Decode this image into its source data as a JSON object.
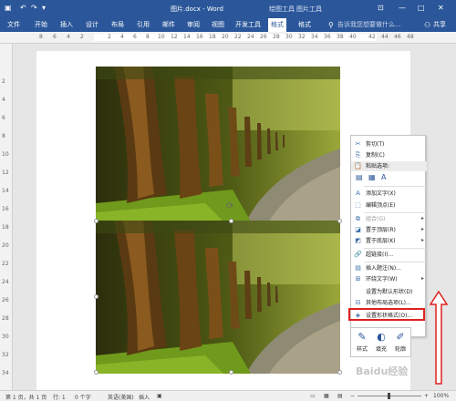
{
  "titlebar": {
    "doc_title": "图片.docx - Word",
    "context_tab_drawing": "绘图工具",
    "context_tab_picture": "图片工具",
    "colors": {
      "bar": "#2b579a"
    }
  },
  "tabs": [
    "文件",
    "开始",
    "插入",
    "设计",
    "布局",
    "引用",
    "邮件",
    "审阅",
    "视图",
    "开发工具",
    "格式",
    "格式"
  ],
  "tell_me": {
    "placeholder": "告诉我您想要做什么..."
  },
  "share": {
    "label": "共享"
  },
  "ruler": {
    "h_numbers": [
      "8",
      "6",
      "4",
      "2",
      "2",
      "4",
      "6",
      "8",
      "10",
      "12",
      "14",
      "16",
      "18",
      "20",
      "22",
      "24",
      "26",
      "28",
      "30",
      "32",
      "34",
      "36",
      "38",
      "40",
      "42",
      "44",
      "46",
      "48"
    ],
    "v_numbers": [
      "2",
      "4",
      "6",
      "8",
      "10",
      "12",
      "14",
      "16",
      "18",
      "20",
      "22",
      "24",
      "26",
      "28",
      "30",
      "32",
      "34"
    ]
  },
  "context_menu": {
    "items": [
      {
        "label": "剪切(T)",
        "icon": "cut-icon",
        "disabled": false,
        "submenu": false
      },
      {
        "label": "复制(C)",
        "icon": "copy-icon",
        "disabled": false,
        "submenu": false
      },
      {
        "label": "粘贴选项:",
        "icon": "paste-icon",
        "disabled": false,
        "submenu": false
      },
      {
        "label": "添加文字(X)",
        "icon": "text-icon",
        "disabled": false,
        "submenu": false
      },
      {
        "label": "编辑顶点(E)",
        "icon": "edit-points-icon",
        "disabled": false,
        "submenu": false
      },
      {
        "label": "组合(G)",
        "icon": "group-icon",
        "disabled": true,
        "submenu": true
      },
      {
        "label": "置于顶层(R)",
        "icon": "bring-front-icon",
        "disabled": false,
        "submenu": true
      },
      {
        "label": "置于底层(K)",
        "icon": "send-back-icon",
        "disabled": false,
        "submenu": true
      },
      {
        "label": "超链接(I)...",
        "icon": "link-icon",
        "disabled": false,
        "submenu": false
      },
      {
        "label": "插入题注(N)...",
        "icon": "caption-icon",
        "disabled": false,
        "submenu": false
      },
      {
        "label": "环绕文字(W)",
        "icon": "wrap-icon",
        "disabled": false,
        "submenu": true
      },
      {
        "label": "设置为默认形状(D)",
        "icon": "",
        "disabled": false,
        "submenu": false
      },
      {
        "label": "其他布局选项(L)...",
        "icon": "layout-icon",
        "disabled": false,
        "submenu": false
      },
      {
        "label": "设置形状格式(O)...",
        "icon": "format-shape-icon",
        "disabled": false,
        "submenu": false
      }
    ],
    "highlighted": "设置形状格式(O)...",
    "highlight_color": "#e02020"
  },
  "mini_toolbar": {
    "buttons": [
      {
        "label": "样式",
        "icon": "style-icon"
      },
      {
        "label": "填充",
        "icon": "fill-icon"
      },
      {
        "label": "轮廓",
        "icon": "outline-icon"
      }
    ]
  },
  "status": {
    "page": "第 1 页，共 1 页",
    "line": "行: 1",
    "words": "0 个字",
    "lang": "英语(美国)",
    "mode": "插入",
    "zoom": "100%"
  },
  "watermark": "Baidu经验"
}
